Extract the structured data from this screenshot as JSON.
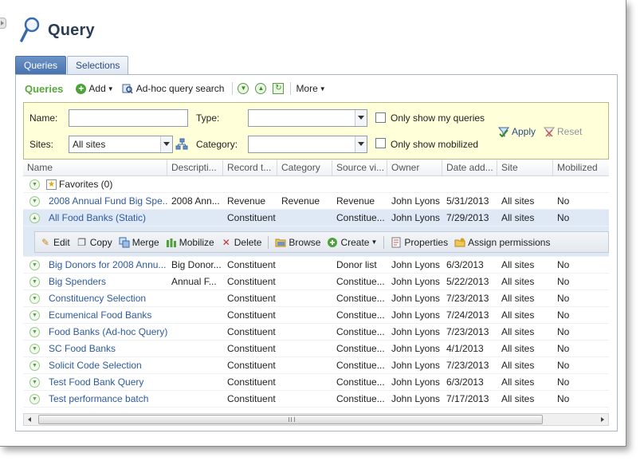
{
  "page": {
    "title": "Query"
  },
  "tabs": [
    {
      "label": "Queries",
      "active": true
    },
    {
      "label": "Selections",
      "active": false
    }
  ],
  "toolbar": {
    "title": "Queries",
    "add_label": "Add",
    "adhoc_label": "Ad-hoc query search",
    "more_label": "More"
  },
  "filters": {
    "name_label": "Name:",
    "name_value": "",
    "type_label": "Type:",
    "type_value": "",
    "only_my_label": "Only show my queries",
    "sites_label": "Sites:",
    "sites_value": "All sites",
    "category_label": "Category:",
    "category_value": "",
    "only_mobilized_label": "Only show mobilized",
    "apply_label": "Apply",
    "reset_label": "Reset"
  },
  "grid": {
    "columns": [
      "Name",
      "Descripti...",
      "Record t...",
      "Category",
      "Source vi...",
      "Owner",
      "Date add...",
      "Site",
      "Mobilized"
    ],
    "favorites_label": "Favorites (0)",
    "rows_top": [
      [
        "2008 Annual Fund Big Spe...",
        "2008 Ann...",
        "Revenue",
        "Revenue",
        "Revenue",
        "John Lyons",
        "5/31/2013",
        "All sites",
        "No"
      ],
      [
        "All Food Banks (Static)",
        "",
        "Constituent",
        "",
        "Constitue...",
        "John Lyons",
        "7/29/2013",
        "All sites",
        "No"
      ]
    ],
    "rows_bottom": [
      [
        "Big Donors for 2008 Annu...",
        "Big Donor...",
        "Constituent",
        "",
        "Donor list",
        "John Lyons",
        "6/3/2013",
        "All sites",
        "No"
      ],
      [
        "Big Spenders",
        "Annual F...",
        "Constituent",
        "",
        "Constitue...",
        "John Lyons",
        "5/22/2013",
        "All sites",
        "No"
      ],
      [
        "Constituency Selection",
        "",
        "Constituent",
        "",
        "Constitue...",
        "John Lyons",
        "7/23/2013",
        "All sites",
        "No"
      ],
      [
        "Ecumenical Food Banks",
        "",
        "Constituent",
        "",
        "Constitue...",
        "John Lyons",
        "7/24/2013",
        "All sites",
        "No"
      ],
      [
        "Food Banks (Ad-hoc Query)",
        "",
        "Constituent",
        "",
        "Constitue...",
        "John Lyons",
        "7/23/2013",
        "All sites",
        "No"
      ],
      [
        "SC Food Banks",
        "",
        "Constituent",
        "",
        "Constitue...",
        "John Lyons",
        "4/1/2013",
        "All sites",
        "No"
      ],
      [
        "Solicit Code Selection",
        "",
        "Constituent",
        "",
        "Constitue...",
        "John Lyons",
        "7/23/2013",
        "All sites",
        "No"
      ],
      [
        "Test Food Bank Query",
        "",
        "Constituent",
        "",
        "Constitue...",
        "John Lyons",
        "6/3/2013",
        "All sites",
        "No"
      ],
      [
        "Test performance batch",
        "",
        "Constituent",
        "",
        "Constitue...",
        "John Lyons",
        "7/17/2013",
        "All sites",
        "No"
      ]
    ]
  },
  "actions": {
    "edit": "Edit",
    "copy": "Copy",
    "merge": "Merge",
    "mobilize": "Mobilize",
    "delete": "Delete",
    "browse": "Browse",
    "create": "Create",
    "properties": "Properties",
    "assign_permissions": "Assign permissions"
  },
  "colors": {
    "accent_green": "#58a83b",
    "tab_active": "#4873b0",
    "link": "#2e5a9c",
    "filter_bg": "#ffffd9",
    "selected_row": "#dfe9f6"
  },
  "scrollbar_grip": "III"
}
